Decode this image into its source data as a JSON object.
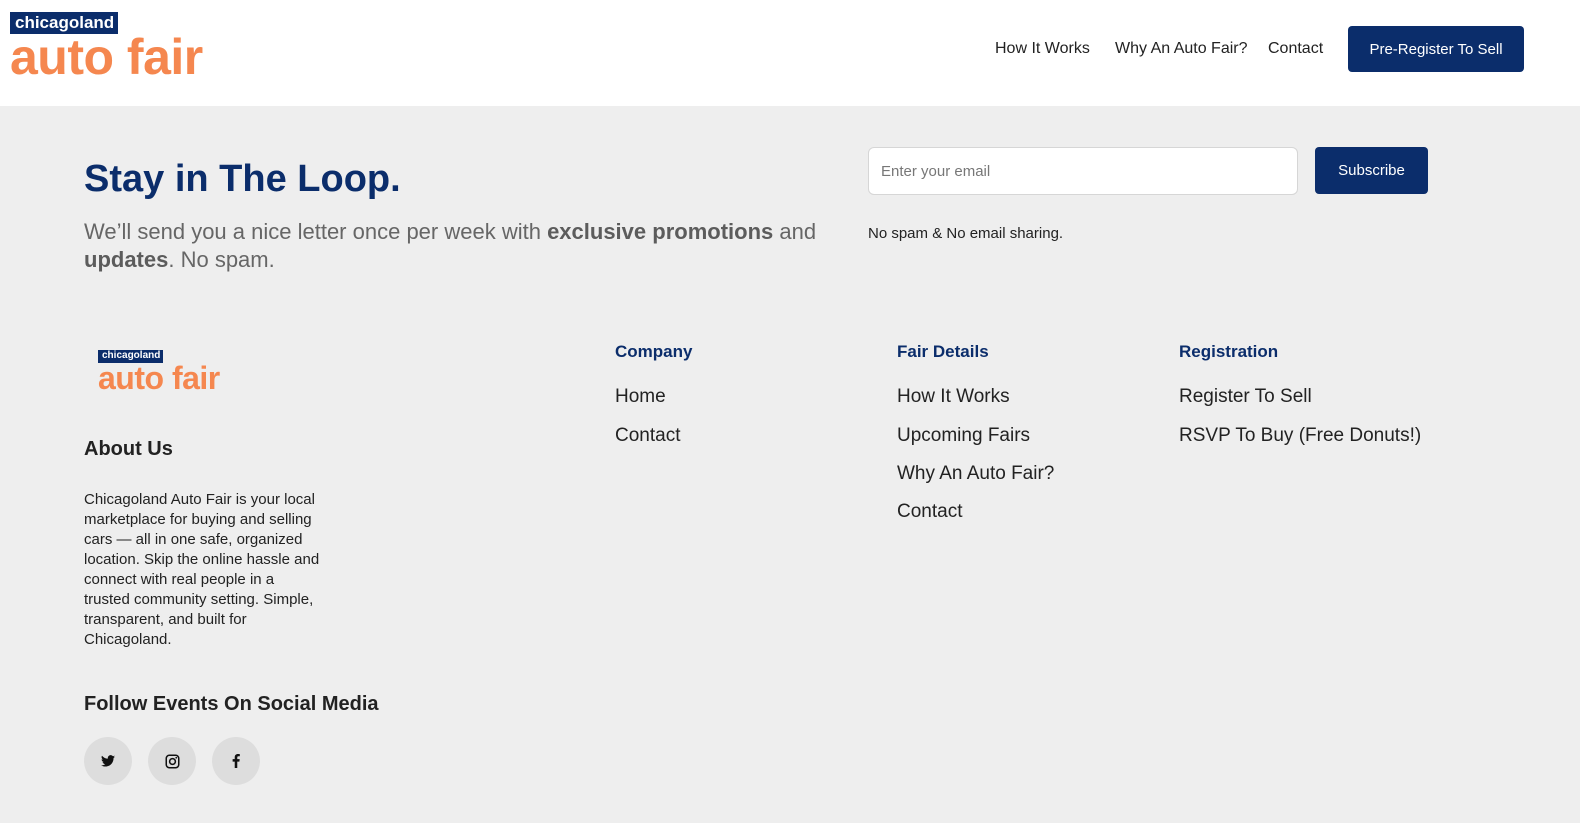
{
  "brand": {
    "tag": "chicagoland",
    "word": "auto fair",
    "colors": {
      "navy": "#0b2d6b",
      "orange": "#f5874f"
    }
  },
  "header": {
    "nav": [
      {
        "label": "How It Works"
      },
      {
        "label": "Why An Auto Fair?"
      },
      {
        "label": "Contact"
      }
    ],
    "cta_label": "Pre-Register To Sell"
  },
  "newsletter": {
    "title": "Stay in The Loop.",
    "desc_part1": "We’ll send you a nice letter once per week with ",
    "desc_bold1": "exclusive promotions",
    "desc_part2": " and ",
    "desc_bold2": "updates",
    "desc_part3": ". No spam.",
    "email_placeholder": "Enter your email",
    "subscribe_label": "Subscribe",
    "note": "No spam & No email sharing."
  },
  "footer": {
    "about_title": "About Us",
    "about_text": "Chicagoland Auto Fair is your local marketplace for buying and selling cars — all in one safe, organized location. Skip the online hassle and connect with real people in a trusted community setting. Simple, transparent, and built for Chicagoland.",
    "follow_title": "Follow Events On Social Media",
    "social_icons": [
      "twitter-icon",
      "instagram-icon",
      "facebook-icon"
    ],
    "columns": [
      {
        "heading": "Company",
        "links": [
          "Home",
          "Contact"
        ]
      },
      {
        "heading": "Fair Details",
        "links": [
          "How It Works",
          "Upcoming Fairs",
          "Why An Auto Fair?",
          "Contact"
        ]
      },
      {
        "heading": "Registration",
        "links": [
          "Register To Sell",
          "RSVP To Buy (Free Donuts!)"
        ]
      }
    ]
  }
}
